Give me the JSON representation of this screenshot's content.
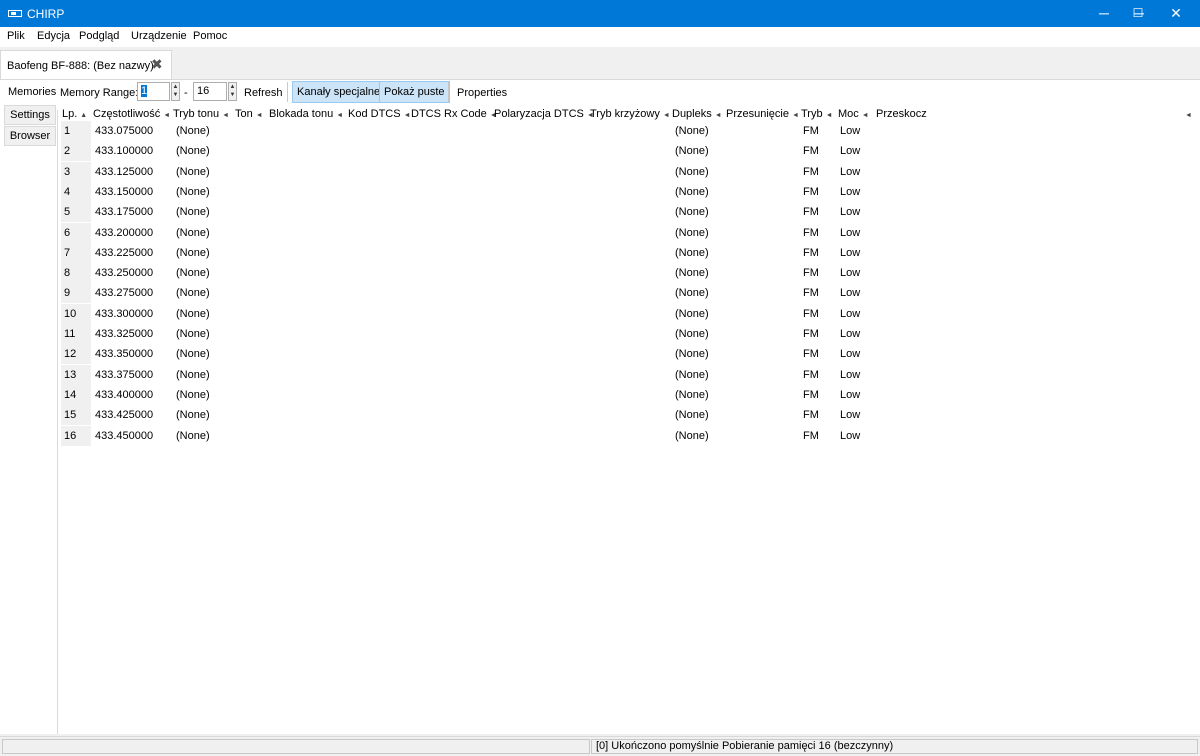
{
  "window": {
    "title": "CHIRP",
    "minimize": "─",
    "maximize": "☐",
    "close": "✕"
  },
  "menu": [
    "Plik",
    "Edycja",
    "Podgląd",
    "Urządzenie",
    "Pomoc"
  ],
  "document_tab": {
    "label": "Baofeng BF-888: (Bez nazwy)*",
    "close": "✖"
  },
  "side_tabs": {
    "memories": "Memories",
    "settings": "Settings",
    "browser": "Browser"
  },
  "toolbar": {
    "range_label": "Memory Range:",
    "range_from": "1",
    "range_dash": "-",
    "range_to": "16",
    "refresh": "Refresh",
    "special": "Kanały specjalne",
    "show_empty": "Pokaż puste",
    "properties": "Properties"
  },
  "columns": [
    "Lp.",
    "Częstotliwość",
    "Tryb tonu",
    "Ton",
    "Blokada tonu",
    "Kod DTCS",
    "DTCS Rx Code",
    "Polaryzacja DTCS",
    "Tryb krzyżowy",
    "Dupleks",
    "Przesunięcie",
    "Tryb",
    "Moc",
    "Przeskocz"
  ],
  "sort_arrows": {
    "asc": "▲",
    "left": "◄"
  },
  "rows": [
    {
      "n": "1",
      "freq": "433.075000",
      "tone": "(None)",
      "duplex": "(None)",
      "mode": "FM",
      "power": "Low"
    },
    {
      "n": "2",
      "freq": "433.100000",
      "tone": "(None)",
      "duplex": "(None)",
      "mode": "FM",
      "power": "Low"
    },
    {
      "n": "3",
      "freq": "433.125000",
      "tone": "(None)",
      "duplex": "(None)",
      "mode": "FM",
      "power": "Low"
    },
    {
      "n": "4",
      "freq": "433.150000",
      "tone": "(None)",
      "duplex": "(None)",
      "mode": "FM",
      "power": "Low"
    },
    {
      "n": "5",
      "freq": "433.175000",
      "tone": "(None)",
      "duplex": "(None)",
      "mode": "FM",
      "power": "Low"
    },
    {
      "n": "6",
      "freq": "433.200000",
      "tone": "(None)",
      "duplex": "(None)",
      "mode": "FM",
      "power": "Low"
    },
    {
      "n": "7",
      "freq": "433.225000",
      "tone": "(None)",
      "duplex": "(None)",
      "mode": "FM",
      "power": "Low"
    },
    {
      "n": "8",
      "freq": "433.250000",
      "tone": "(None)",
      "duplex": "(None)",
      "mode": "FM",
      "power": "Low"
    },
    {
      "n": "9",
      "freq": "433.275000",
      "tone": "(None)",
      "duplex": "(None)",
      "mode": "FM",
      "power": "Low"
    },
    {
      "n": "10",
      "freq": "433.300000",
      "tone": "(None)",
      "duplex": "(None)",
      "mode": "FM",
      "power": "Low"
    },
    {
      "n": "11",
      "freq": "433.325000",
      "tone": "(None)",
      "duplex": "(None)",
      "mode": "FM",
      "power": "Low"
    },
    {
      "n": "12",
      "freq": "433.350000",
      "tone": "(None)",
      "duplex": "(None)",
      "mode": "FM",
      "power": "Low"
    },
    {
      "n": "13",
      "freq": "433.375000",
      "tone": "(None)",
      "duplex": "(None)",
      "mode": "FM",
      "power": "Low"
    },
    {
      "n": "14",
      "freq": "433.400000",
      "tone": "(None)",
      "duplex": "(None)",
      "mode": "FM",
      "power": "Low"
    },
    {
      "n": "15",
      "freq": "433.425000",
      "tone": "(None)",
      "duplex": "(None)",
      "mode": "FM",
      "power": "Low"
    },
    {
      "n": "16",
      "freq": "433.450000",
      "tone": "(None)",
      "duplex": "(None)",
      "mode": "FM",
      "power": "Low"
    }
  ],
  "status": {
    "message": "[0] Ukończono pomyślnie Pobieranie pamięci 16 (bezczynny)"
  },
  "colors": {
    "titlebar": "#0078d7",
    "active_button": "#cce4f7"
  }
}
